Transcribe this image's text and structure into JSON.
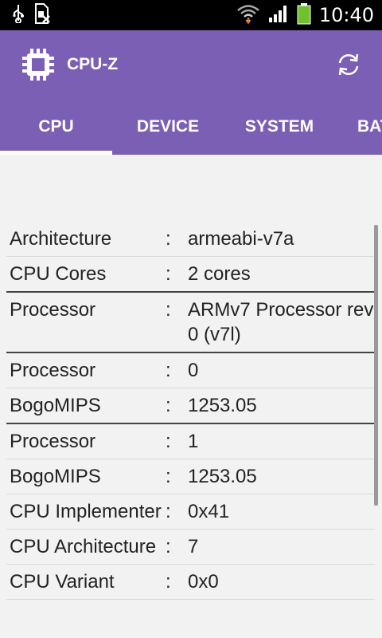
{
  "status_bar": {
    "time": "10:40"
  },
  "app": {
    "title": "CPU-Z",
    "accent": "#7b5fb5"
  },
  "tabs": [
    {
      "label": "CPU",
      "selected": true
    },
    {
      "label": "DEVICE",
      "selected": false
    },
    {
      "label": "SYSTEM",
      "selected": false
    },
    {
      "label": "BAT",
      "selected": false
    }
  ],
  "rows": [
    {
      "label": "Architecture",
      "sep": ":",
      "value": "armeabi-v7a"
    },
    {
      "label": "CPU Cores",
      "sep": ":",
      "value": "2 cores"
    },
    {
      "label": "Processor",
      "sep": ":",
      "value": "ARMv7 Processor rev 0 (v7l)"
    },
    {
      "label": "Processor",
      "sep": ":",
      "value": "0"
    },
    {
      "label": "BogoMIPS",
      "sep": ":",
      "value": "1253.05"
    },
    {
      "label": "Processor",
      "sep": ":",
      "value": "1"
    },
    {
      "label": "BogoMIPS",
      "sep": ":",
      "value": "1253.05"
    },
    {
      "label": "CPU Implementer",
      "sep": ":",
      "value": "0x41"
    },
    {
      "label": "CPU Architecture",
      "sep": ":",
      "value": "7"
    },
    {
      "label": "CPU Variant",
      "sep": ":",
      "value": "0x0"
    }
  ]
}
